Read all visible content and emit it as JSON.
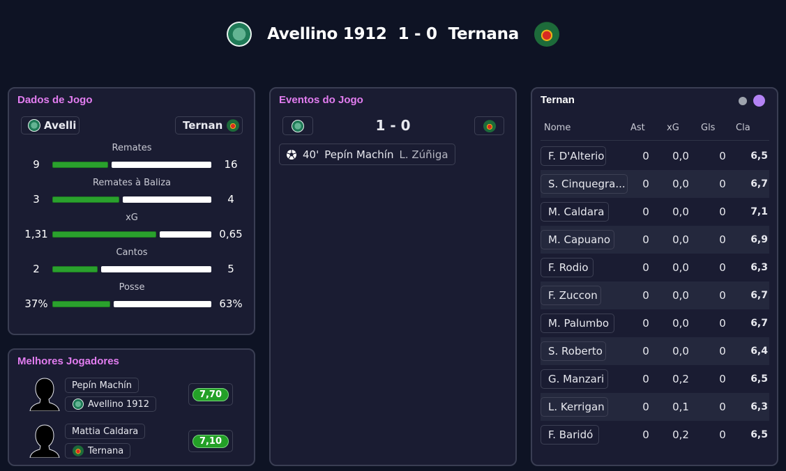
{
  "match": {
    "home": "Avellino 1912",
    "score": "1 - 0",
    "away": "Ternana",
    "home_crest": "avellino-crest-icon",
    "away_crest": "ternana-crest-icon"
  },
  "game_stats": {
    "title": "Dados de Jogo",
    "home_chip": "Avelli",
    "away_chip": "Ternan",
    "stats": [
      {
        "label": "Remates",
        "home": "9",
        "away": "16",
        "home_share": 0.36
      },
      {
        "label": "Remates à Baliza",
        "home": "3",
        "away": "4",
        "home_share": 0.43
      },
      {
        "label": "xG",
        "home": "1,31",
        "away": "0,65",
        "home_share": 0.67
      },
      {
        "label": "Cantos",
        "home": "2",
        "away": "5",
        "home_share": 0.29
      },
      {
        "label": "Posse",
        "home": "37%",
        "away": "63%",
        "home_share": 0.37
      }
    ]
  },
  "best_players": {
    "title": "Melhores Jogadores",
    "players": [
      {
        "name": "Pepín Machín",
        "team": "Avellino 1912",
        "rating": "7,70"
      },
      {
        "name": "Mattia Caldara",
        "team": "Ternana",
        "rating": "7,10"
      }
    ]
  },
  "events": {
    "title": "Eventos do Jogo",
    "score": "1 - 0",
    "items": [
      {
        "minute": "40'",
        "scorer": "Pepín Machín",
        "assist": "L. Zúñiga",
        "icon": "football-icon"
      }
    ]
  },
  "lineup": {
    "title": "Ternan",
    "columns": [
      "Nome",
      "Ast",
      "xG",
      "Gls",
      "Cla"
    ],
    "toggle_colors": [
      "#9ea3ad",
      "#b483f5"
    ],
    "rows": [
      {
        "name": "F. D'Alterio",
        "ast": "0",
        "xg": "0,0",
        "gls": "0",
        "cla": "6,5"
      },
      {
        "name": "S. Cinquegra...",
        "ast": "0",
        "xg": "0,0",
        "gls": "0",
        "cla": "6,7"
      },
      {
        "name": "M. Caldara",
        "ast": "0",
        "xg": "0,0",
        "gls": "0",
        "cla": "7,1"
      },
      {
        "name": "M. Capuano",
        "ast": "0",
        "xg": "0,0",
        "gls": "0",
        "cla": "6,9"
      },
      {
        "name": "F. Rodio",
        "ast": "0",
        "xg": "0,0",
        "gls": "0",
        "cla": "6,3"
      },
      {
        "name": "F. Zuccon",
        "ast": "0",
        "xg": "0,0",
        "gls": "0",
        "cla": "6,7"
      },
      {
        "name": "M. Palumbo",
        "ast": "0",
        "xg": "0,0",
        "gls": "0",
        "cla": "6,7"
      },
      {
        "name": "S. Roberto",
        "ast": "0",
        "xg": "0,0",
        "gls": "0",
        "cla": "6,4"
      },
      {
        "name": "G. Manzari",
        "ast": "0",
        "xg": "0,2",
        "gls": "0",
        "cla": "6,5"
      },
      {
        "name": "L. Kerrigan",
        "ast": "0",
        "xg": "0,1",
        "gls": "0",
        "cla": "6,3"
      },
      {
        "name": "F. Baridó",
        "ast": "0",
        "xg": "0,2",
        "gls": "0",
        "cla": "6,5"
      }
    ]
  }
}
